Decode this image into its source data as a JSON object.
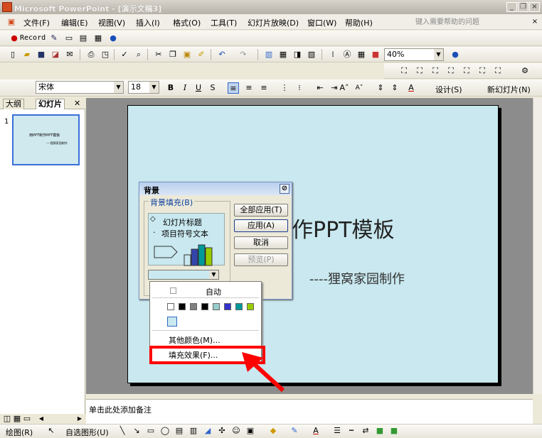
{
  "window": {
    "title": "Microsoft PowerPoint - [演示文稿3]",
    "help_placeholder": "键入需要帮助的问题"
  },
  "menu": {
    "items": [
      "文件(F)",
      "编辑(E)",
      "视图(V)",
      "插入(I)",
      "格式(O)",
      "工具(T)",
      "幻灯片放映(D)",
      "窗口(W)",
      "帮助(H)"
    ]
  },
  "record_toolbar": {
    "record_label": "Record"
  },
  "standard_toolbar": {
    "zoom": "40%"
  },
  "format_toolbar": {
    "font": "宋体",
    "size": "18",
    "design_label": "设计(S)",
    "new_slide_label": "新幻灯片(N)"
  },
  "left_pane": {
    "tabs": [
      "大纲",
      "幻灯片"
    ],
    "slide_number": "1",
    "thumb_title": "用PPT制作PPT模板",
    "thumb_sub": "----狸窝家园制作"
  },
  "slide": {
    "title": "作PPT模板",
    "subtitle": "----狸窝家园制作"
  },
  "notes": {
    "placeholder": "单击此处添加备注"
  },
  "dialog": {
    "title": "背景",
    "fill_legend": "背景填充(B)",
    "preview_title": "幻灯片标题",
    "preview_bullet": "项目符号文本",
    "buttons": {
      "apply_all": "全部应用(T)",
      "apply": "应用(A)",
      "cancel": "取消",
      "preview": "预览(P)"
    }
  },
  "popup": {
    "auto": "自动",
    "more_colors": "其他颜色(M)...",
    "fill_effects": "填充效果(F)..."
  },
  "colors": {
    "swatches": [
      "#ffffff",
      "#000000",
      "#808080",
      "#000000",
      "#99cccc",
      "#3333cc",
      "#009999",
      "#99cc00"
    ],
    "highlight": "#ff0000"
  },
  "draw_toolbar": {
    "draw_label": "绘图(R)",
    "autoshape_label": "自选图形(U)"
  }
}
